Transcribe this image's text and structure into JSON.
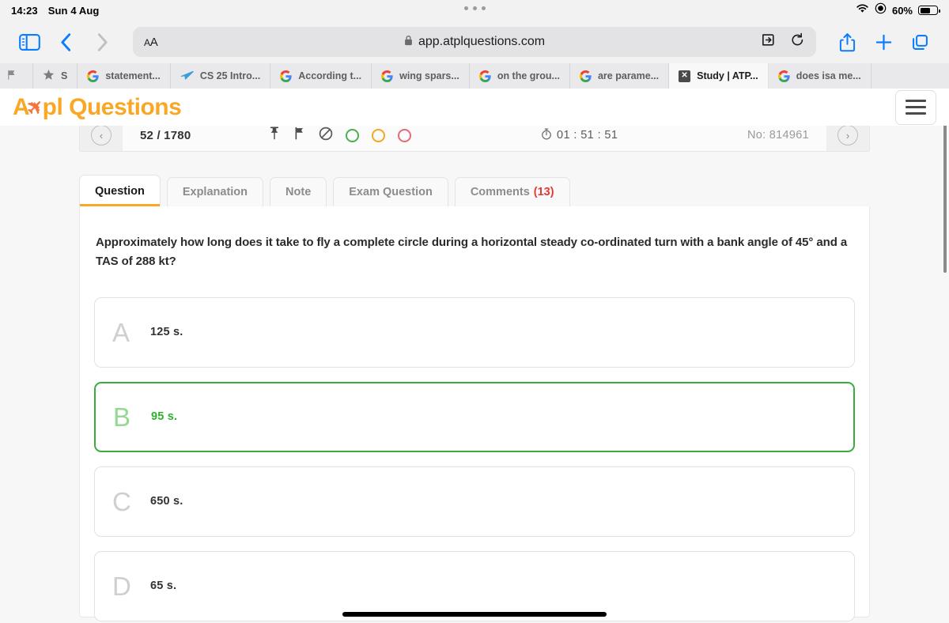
{
  "statusbar": {
    "time": "14:23",
    "date": "Sun 4 Aug",
    "battery_percent": "60%",
    "icons": [
      "wifi-icon",
      "rotation-lock-icon",
      "battery-icon"
    ]
  },
  "browser": {
    "back_icon": "chevron-left-icon",
    "forward_icon": "chevron-right-icon",
    "sidebar_icon": "sidebar-icon",
    "reader_label": "AA",
    "lock_icon": "lock-icon",
    "url": "app.atplquestions.com",
    "extensions_icon": "extensions-icon",
    "reload_icon": "reload-icon",
    "share_icon": "share-icon",
    "newtab_icon": "plus-icon",
    "tabs_icon": "tab-overview-icon"
  },
  "bookmarks": [
    {
      "label": "",
      "icon": "flag-icon",
      "active": false
    },
    {
      "label": "S",
      "icon": "star-icon",
      "active": false
    },
    {
      "label": "statement...",
      "icon": "google-icon",
      "active": false
    },
    {
      "label": "CS 25 Intro...",
      "icon": "plane-icon",
      "active": false
    },
    {
      "label": "According t...",
      "icon": "google-icon",
      "active": false
    },
    {
      "label": "wing spars...",
      "icon": "google-icon",
      "active": false
    },
    {
      "label": "on the grou...",
      "icon": "google-icon",
      "active": false
    },
    {
      "label": "are parame...",
      "icon": "google-icon",
      "active": false
    },
    {
      "label": "Study | ATP...",
      "icon": "atpl-favicon",
      "active": true
    },
    {
      "label": "does isa me...",
      "icon": "google-icon",
      "active": false
    }
  ],
  "site": {
    "logo_text_a": "A",
    "logo_plane": "✈",
    "logo_text_b": "pl Questions",
    "menu_icon": "hamburger-icon"
  },
  "navbar": {
    "prev_icon": "chevron-left-circle-icon",
    "next_icon": "chevron-right-circle-icon",
    "counter": "52 / 1780",
    "markers": [
      "pin-icon",
      "flag-icon",
      "ban-icon",
      "green-ring",
      "amber-ring",
      "red-ring"
    ],
    "timer_icon": "stopwatch-icon",
    "timer": "01 : 51 : 51",
    "question_no": "No: 814961"
  },
  "tabs": [
    {
      "label": "Question",
      "active": true,
      "count": ""
    },
    {
      "label": "Explanation",
      "active": false,
      "count": ""
    },
    {
      "label": "Note",
      "active": false,
      "count": ""
    },
    {
      "label": "Exam Question",
      "active": false,
      "count": ""
    },
    {
      "label": "Comments",
      "active": false,
      "count": "(13)"
    }
  ],
  "question": {
    "text": "Approximately how long does it take to fly a complete circle during a horizontal steady co-ordinated turn with a bank angle of 45° and a TAS of 288 kt?",
    "options": [
      {
        "letter": "A",
        "text": "125 s.",
        "correct": false
      },
      {
        "letter": "B",
        "text": "95 s.",
        "correct": true
      },
      {
        "letter": "C",
        "text": "650 s.",
        "correct": false
      },
      {
        "letter": "D",
        "text": "65 s.",
        "correct": false
      }
    ]
  },
  "colors": {
    "brand": "#f9a825",
    "correct": "#2db22d",
    "comments_count": "#e53935",
    "browser_accent": "#0a7cff"
  }
}
